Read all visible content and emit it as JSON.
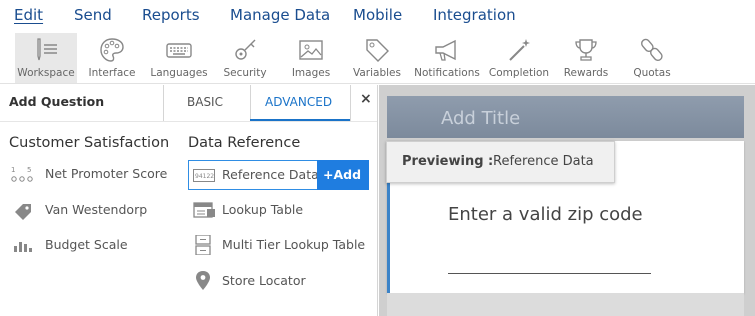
{
  "top_menu": [
    "Edit",
    "Send",
    "Reports",
    "Manage Data",
    "Mobile",
    "Integration"
  ],
  "toolbar": [
    {
      "label": "Workspace",
      "icon": "workspace-icon"
    },
    {
      "label": "Interface",
      "icon": "palette-icon"
    },
    {
      "label": "Languages",
      "icon": "keyboard-icon"
    },
    {
      "label": "Security",
      "icon": "key-icon"
    },
    {
      "label": "Images",
      "icon": "image-icon"
    },
    {
      "label": "Variables",
      "icon": "tag-icon"
    },
    {
      "label": "Notifications",
      "icon": "megaphone-icon"
    },
    {
      "label": "Completion",
      "icon": "magic-wand-icon"
    },
    {
      "label": "Rewards",
      "icon": "trophy-icon"
    },
    {
      "label": "Quotas",
      "icon": "chain-link-icon"
    }
  ],
  "panel": {
    "title": "Add Question",
    "tabs": [
      "BASIC",
      "ADVANCED"
    ],
    "active_tab": "ADVANCED",
    "close": "×"
  },
  "customer_satisfaction": {
    "heading": "Customer Satisfaction",
    "items": [
      {
        "label": "Net Promoter Score",
        "icon": "nps-scale-icon"
      },
      {
        "label": "Van Westendorp",
        "icon": "price-tag-icon"
      },
      {
        "label": "Budget Scale",
        "icon": "bar-chart-icon"
      }
    ]
  },
  "data_reference": {
    "heading": "Data Reference",
    "items": [
      {
        "label": "Reference Data",
        "icon": "reference-data-icon"
      },
      {
        "label": "Lookup Table",
        "icon": "lookup-table-icon"
      },
      {
        "label": "Multi Tier Lookup Table",
        "icon": "multi-tier-icon"
      },
      {
        "label": "Store Locator",
        "icon": "map-pin-icon"
      }
    ],
    "add_button": "+Add"
  },
  "preview": {
    "add_title_placeholder": "Add Title",
    "previewing_label": "Previewing :",
    "previewing_value": "Reference Data",
    "question_text": "Enter a valid zip code"
  },
  "colors": {
    "accent": "#1f7de0",
    "nav": "#1a4d8f",
    "titlebar": "#8795a6"
  }
}
